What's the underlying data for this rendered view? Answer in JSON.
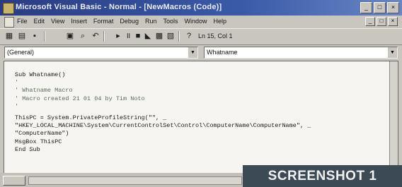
{
  "window": {
    "title": "Microsoft Visual Basic - Normal - [NewMacros (Code)]",
    "controls": [
      "_",
      "□",
      "×"
    ]
  },
  "menubar": {
    "items": [
      "File",
      "Edit",
      "View",
      "Insert",
      "Format",
      "Debug",
      "Run",
      "Tools",
      "Window",
      "Help"
    ],
    "doc_controls": [
      "_",
      "□",
      "×"
    ]
  },
  "toolbar": {
    "position": "Ln 15, Col 1"
  },
  "combos": {
    "object": "(General)",
    "procedure": "Whatname"
  },
  "code": {
    "lines": [
      "Sub Whatname()",
      "'",
      "' Whatname Macro",
      "' Macro created 21 01 04 by Tim Noto",
      "'",
      "ThisPC = System.PrivateProfileString(\"\", _",
      "\"HKEY_LOCAL_MACHINE\\System\\CurrentControlSet\\Control\\ComputerName\\ComputerName\", _",
      "\"ComputerName\")",
      "MsgBox ThisPC",
      "End Sub"
    ]
  },
  "overlay": {
    "label": "SCREENSHOT 1"
  }
}
